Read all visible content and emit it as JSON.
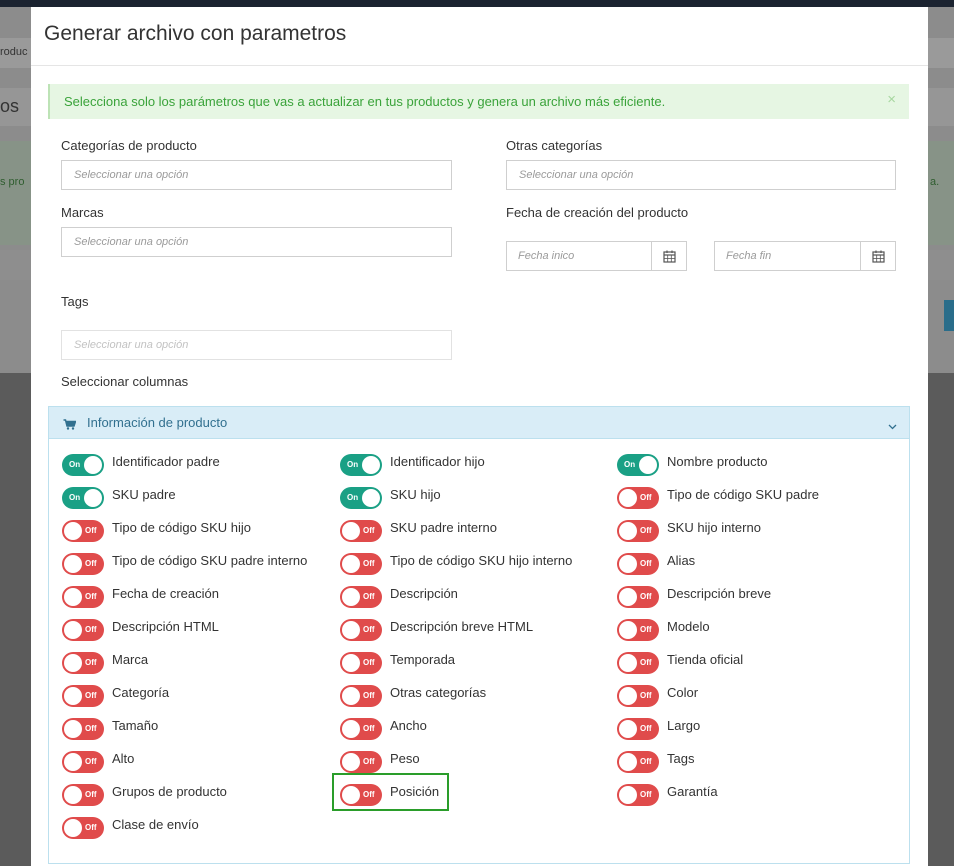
{
  "background": {
    "crumb_fragment": "roduc",
    "title_fragment": "os",
    "text_left_fragment": "s pro",
    "text_right_fragment": "a."
  },
  "modal": {
    "title": "Generar archivo con parametros",
    "alert": {
      "text": "Selecciona solo los parámetros que vas a actualizar en tus productos y genera un archivo más eficiente.",
      "close": "×"
    },
    "filters": {
      "categorias": {
        "label": "Categorías de producto",
        "placeholder": "Seleccionar una opción"
      },
      "otras": {
        "label": "Otras categorías",
        "placeholder": "Seleccionar una opción"
      },
      "marcas": {
        "label": "Marcas",
        "placeholder": "Seleccionar una opción"
      },
      "fecha": {
        "label": "Fecha de creación del producto",
        "inicio_placeholder": "Fecha inico",
        "fin_placeholder": "Fecha fin"
      },
      "tags": {
        "label": "Tags",
        "placeholder": "Seleccionar una opción"
      }
    },
    "columns_label": "Seleccionar columnas",
    "panel": {
      "title": "Información de producto",
      "toggle_on_text": "On",
      "toggle_off_text": "Off",
      "items": [
        {
          "label": "Identificador padre",
          "on": true
        },
        {
          "label": "Identificador hijo",
          "on": true
        },
        {
          "label": "Nombre producto",
          "on": true
        },
        {
          "label": "SKU padre",
          "on": true
        },
        {
          "label": "SKU hijo",
          "on": true
        },
        {
          "label": "Tipo de código SKU padre",
          "on": false
        },
        {
          "label": "Tipo de código SKU hijo",
          "on": false
        },
        {
          "label": "SKU padre interno",
          "on": false
        },
        {
          "label": "SKU hijo interno",
          "on": false
        },
        {
          "label": "Tipo de código SKU padre interno",
          "on": false
        },
        {
          "label": "Tipo de código SKU hijo interno",
          "on": false
        },
        {
          "label": "Alias",
          "on": false
        },
        {
          "label": "Fecha de creación",
          "on": false
        },
        {
          "label": "Descripción",
          "on": false
        },
        {
          "label": "Descripción breve",
          "on": false
        },
        {
          "label": "Descripción HTML",
          "on": false
        },
        {
          "label": "Descripción breve HTML",
          "on": false
        },
        {
          "label": "Modelo",
          "on": false
        },
        {
          "label": "Marca",
          "on": false
        },
        {
          "label": "Temporada",
          "on": false
        },
        {
          "label": "Tienda oficial",
          "on": false
        },
        {
          "label": "Categoría",
          "on": false
        },
        {
          "label": "Otras categorías",
          "on": false
        },
        {
          "label": "Color",
          "on": false
        },
        {
          "label": "Tamaño",
          "on": false
        },
        {
          "label": "Ancho",
          "on": false
        },
        {
          "label": "Largo",
          "on": false
        },
        {
          "label": "Alto",
          "on": false
        },
        {
          "label": "Peso",
          "on": false
        },
        {
          "label": "Tags",
          "on": false
        },
        {
          "label": "Grupos de producto",
          "on": false
        },
        {
          "label": "Posición",
          "on": false
        },
        {
          "label": "Garantía",
          "on": false
        },
        {
          "label": "Clase de envío",
          "on": false
        }
      ]
    }
  },
  "colors": {
    "toggle_on": "#1aa085",
    "toggle_off": "#e04b4b",
    "alert_text": "#3aa33a",
    "panel_heading": "#31708f",
    "highlight": "#2a9d2a"
  }
}
